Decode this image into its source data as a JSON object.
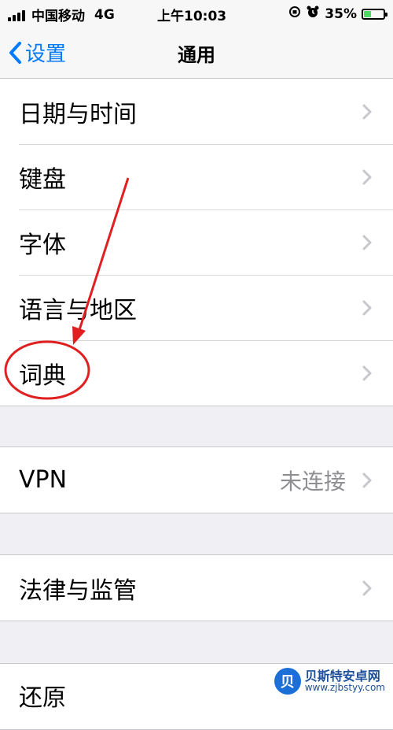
{
  "status_bar": {
    "carrier": "中国移动",
    "network": "4G",
    "time": "上午10:03",
    "battery_percent": "35%",
    "battery_level": 0.35,
    "battery_color": "#4cd964"
  },
  "nav": {
    "back_label": "设置",
    "title": "通用",
    "accent_color": "#007aff"
  },
  "groups": [
    {
      "items": [
        {
          "label": "日期与时间"
        },
        {
          "label": "键盘"
        },
        {
          "label": "字体"
        },
        {
          "label": "语言与地区"
        },
        {
          "label": "词典"
        }
      ]
    },
    {
      "items": [
        {
          "label": "VPN",
          "detail": "未连接"
        }
      ]
    },
    {
      "items": [
        {
          "label": "法律与监管"
        }
      ]
    },
    {
      "items": [
        {
          "label": "还原"
        }
      ]
    }
  ],
  "annotation": {
    "color": "#e02020",
    "target_item": "词典"
  },
  "watermark": {
    "name": "贝斯特安卓网",
    "url": "www.zjbstyy.com",
    "logo_glyph": "贝"
  }
}
